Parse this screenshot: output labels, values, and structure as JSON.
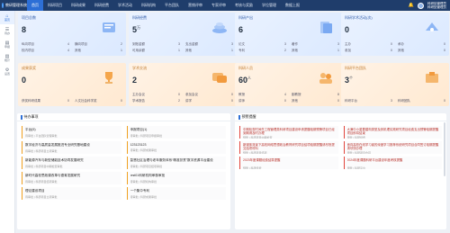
{
  "app": {
    "logo_text": "教研管理系统"
  },
  "nav": [
    "首页",
    "科研项目",
    "科研成果",
    "科研经费",
    "学术活动",
    "科研机构",
    "平台团队",
    "营销评审",
    "专家评审",
    "考核与奖励",
    "学位管理",
    "数据上报"
  ],
  "user": {
    "name": "科研处管理员",
    "role": "科研处管理员"
  },
  "sidebar": [
    {
      "icon": "home-icon",
      "label": "首页"
    },
    {
      "icon": "task-icon",
      "label": "待办"
    },
    {
      "icon": "doc-icon",
      "label": "申报"
    },
    {
      "icon": "stat-icon",
      "label": "统计"
    },
    {
      "icon": "gear-icon",
      "label": "设置"
    }
  ],
  "cards": [
    {
      "title": "项目总数",
      "value": "8",
      "unit": "",
      "tone": "blue",
      "metas": [
        [
          "纵向项目",
          "4"
        ],
        [
          "横向项目",
          "2"
        ],
        [
          "校内项目",
          "4"
        ],
        [
          "其他",
          "1"
        ]
      ]
    },
    {
      "title": "科研经费",
      "value": "5",
      "unit": "万",
      "tone": "blue",
      "metas": [
        [
          "到账金额",
          "3"
        ],
        [
          "支出金额",
          "3"
        ],
        [
          "可用余额",
          "1"
        ],
        [
          "其他",
          "1"
        ]
      ]
    },
    {
      "title": "科研产出",
      "value": "6",
      "unit": "",
      "tone": "blue",
      "metas": [
        [
          "论文",
          "3"
        ],
        [
          "著作",
          "3"
        ],
        [
          "专利",
          "2"
        ],
        [
          "其他",
          "1"
        ]
      ]
    },
    {
      "title": "科研学术活动(次)",
      "value": "0",
      "unit": "",
      "tone": "blue",
      "metas": [
        [
          "主办",
          "0"
        ],
        [
          "承办",
          "0"
        ],
        [
          "参加",
          "0"
        ],
        [
          "其他",
          "0"
        ]
      ]
    },
    {
      "title": "成果获奖",
      "value": "0",
      "unit": "",
      "tone": "orange",
      "metas": [
        [
          "获奖科研成果",
          "0"
        ],
        [
          "人文社会科学奖",
          "0"
        ]
      ]
    },
    {
      "title": "学术交流",
      "value": "2",
      "unit": "",
      "tone": "orange",
      "metas": [
        [
          "主办会议",
          "0"
        ],
        [
          "参加会议",
          "0"
        ],
        [
          "学术报告",
          "2"
        ],
        [
          "讲学",
          "0"
        ]
      ]
    },
    {
      "title": "科研人员",
      "value": "60",
      "unit": "人",
      "tone": "orange",
      "metas": [
        [
          "教授",
          "4"
        ],
        [
          "副教授",
          "8"
        ],
        [
          "讲师",
          "0"
        ],
        [
          "其他",
          "0"
        ]
      ]
    },
    {
      "title": "科研平台团队",
      "value": "3",
      "unit": "个",
      "tone": "orange",
      "metas": [
        [
          "科研平台",
          "3"
        ],
        [
          "科研团队",
          "0"
        ]
      ]
    }
  ],
  "todo_panel": {
    "title": "待办事项",
    "items": [
      {
        "title": "平台(5)",
        "sub": "待审批 | 平台团队管理审批"
      },
      {
        "title": "申报项目(1)",
        "sub": "待审批 | 科研项目申报审批"
      },
      {
        "title": "数字经济与高质量发展推进专业研究基地建设",
        "sub": "待审批 | 科研项目立项审批"
      },
      {
        "title": "123123123",
        "sub": "待审批 | 科研成果审批"
      },
      {
        "title": "新能源汽车与新型储能技术协同发展研究",
        "sub": "待审批 | 科研项目中期检查审批"
      },
      {
        "title": "智慧社区治理与老年服务体系“精准扶贫”数字资源平台建设",
        "sub": "待审批 | 科研项目结项审批"
      },
      {
        "title": "新时代高校思政课改革与德育发展研究",
        "sub": "待审批 | 科研项目结项审批"
      },
      {
        "title": "test01科研机构审核审批",
        "sub": "待审批 | 科研机构审批"
      },
      {
        "title": "理论建设项目",
        "sub": "待审批 | 科研项目立项审批"
      },
      {
        "title": "一个集中专利",
        "sub": "待审批 | 科研成果审批"
      }
    ]
  },
  "warn_panel": {
    "title": "预警提醒",
    "items": [
      {
        "title": "中期检查时间先工程管理类科研项目建设申请提醒临期预警项目已经到期请及时办理",
        "sub": "预警 | 科研项目中期检查"
      },
      {
        "title": "大满中小重要建构类型及其机理实践研究项目经费支出预警临期提醒项目即将结束",
        "sub": "预警 | 科研经费"
      },
      {
        "title": "新媒体背景下高校网络思想政治教育研究项目结项临期提醒请尽快提交结项材料",
        "sub": "预警 | 科研项目结项"
      },
      {
        "title": "面向高校在线学习者的深度学习推荐系统研究项目合同签订临期提醒请尽快办理",
        "sub": "预警 | 科研项目合同"
      },
      {
        "title": "2023年度课题经费结算提醒",
        "sub": "预警 | 科研经费"
      },
      {
        "title": "2024年度课题科研平台建设年度考核提醒",
        "sub": "预警 | 科研平台"
      }
    ]
  },
  "colors": {
    "nav_bg": "#1f3d6b",
    "accent": "#2d6fd6",
    "todo_border": "#f0a020",
    "warn_border": "#e2453c"
  }
}
